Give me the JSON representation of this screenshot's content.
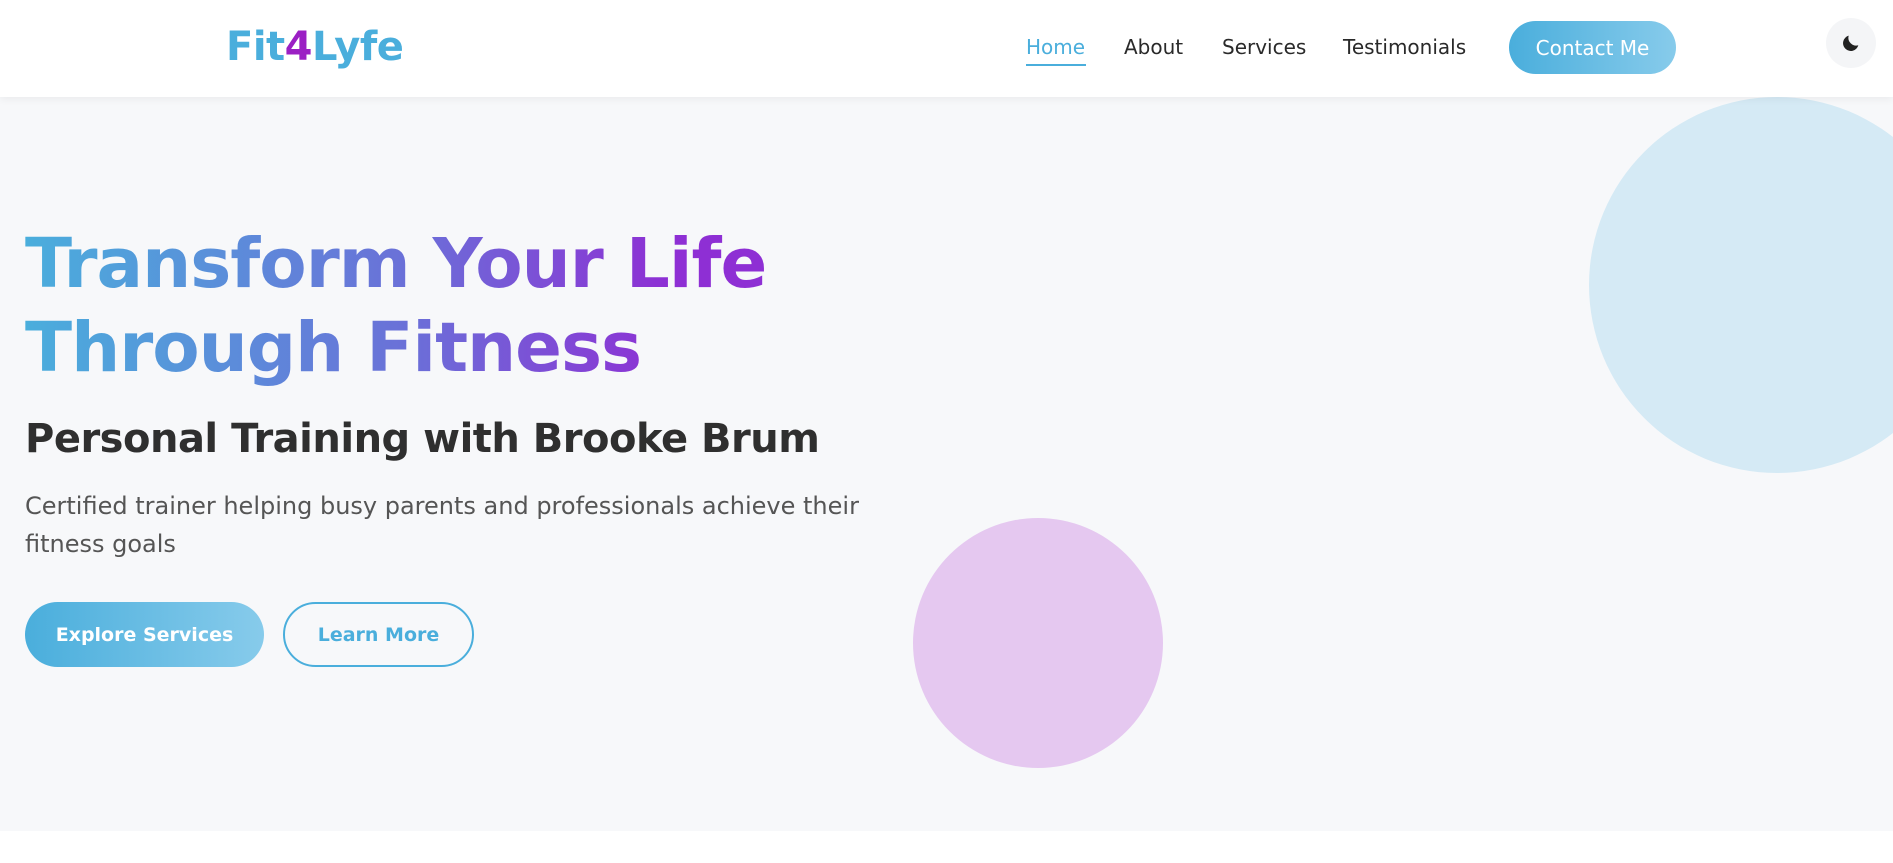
{
  "brand": {
    "logo_part1": "Fit",
    "logo_part2": "4",
    "logo_part3": "Lyfe"
  },
  "nav": {
    "items": [
      {
        "label": "Home",
        "active": true
      },
      {
        "label": "About"
      },
      {
        "label": "Services"
      },
      {
        "label": "Testimonials"
      }
    ],
    "contact_label": "Contact Me",
    "theme_icon": "moon-icon"
  },
  "hero": {
    "title_line1": "Transform Your Life",
    "title_line2": "Through Fitness",
    "subtitle": "Personal Training with Brooke Brum",
    "description": "Certified trainer helping busy parents and professionals achieve their fitness goals",
    "primary_button": "Explore Services",
    "secondary_button": "Learn More"
  },
  "colors": {
    "accent": "#4aaedc",
    "accent_purple": "#9b1fc4",
    "circle_blue": "#d5eaf5",
    "circle_purple": "#e5c8f0"
  }
}
